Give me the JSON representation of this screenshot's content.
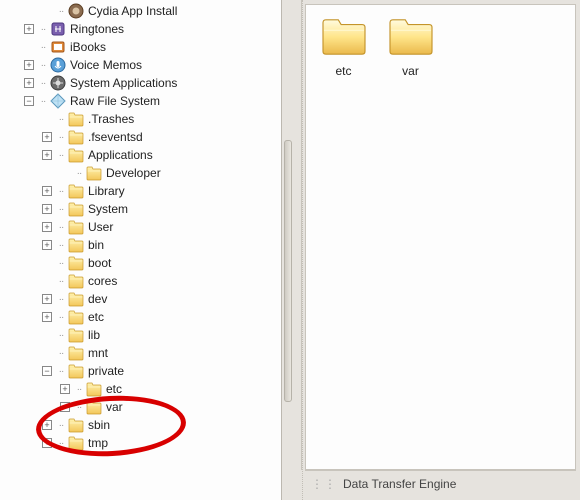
{
  "tree": {
    "top_items": [
      {
        "label": "Cydia App Install",
        "icon": "cydia",
        "depth": 2,
        "expander": "none"
      },
      {
        "label": "Ringtones",
        "icon": "ringtones",
        "depth": 1,
        "expander": "plus"
      },
      {
        "label": "iBooks",
        "icon": "ibooks",
        "depth": 1,
        "expander": "none"
      },
      {
        "label": "Voice Memos",
        "icon": "voice",
        "depth": 1,
        "expander": "plus"
      },
      {
        "label": "System Applications",
        "icon": "sysapps",
        "depth": 1,
        "expander": "plus"
      }
    ],
    "rawfs": {
      "label": "Raw File System",
      "icon": "diamond",
      "depth": 1,
      "expander": "minus",
      "children": [
        {
          "label": ".Trashes",
          "depth": 2,
          "expander": "none"
        },
        {
          "label": ".fseventsd",
          "depth": 2,
          "expander": "plus"
        },
        {
          "label": "Applications",
          "depth": 2,
          "expander": "plus"
        },
        {
          "label": "Developer",
          "depth": 3,
          "expander": "none"
        },
        {
          "label": "Library",
          "depth": 2,
          "expander": "plus"
        },
        {
          "label": "System",
          "depth": 2,
          "expander": "plus"
        },
        {
          "label": "User",
          "depth": 2,
          "expander": "plus"
        },
        {
          "label": "bin",
          "depth": 2,
          "expander": "plus"
        },
        {
          "label": "boot",
          "depth": 2,
          "expander": "none"
        },
        {
          "label": "cores",
          "depth": 2,
          "expander": "none"
        },
        {
          "label": "dev",
          "depth": 2,
          "expander": "plus"
        },
        {
          "label": "etc",
          "depth": 2,
          "expander": "plus"
        },
        {
          "label": "lib",
          "depth": 2,
          "expander": "none"
        },
        {
          "label": "mnt",
          "depth": 2,
          "expander": "none"
        },
        {
          "label": "private",
          "depth": 2,
          "expander": "minus"
        },
        {
          "label": "etc",
          "depth": 3,
          "expander": "plus"
        },
        {
          "label": "var",
          "depth": 3,
          "expander": "plus"
        },
        {
          "label": "sbin",
          "depth": 2,
          "expander": "plus"
        },
        {
          "label": "tmp",
          "depth": 2,
          "expander": "plus"
        }
      ]
    }
  },
  "content": {
    "folders": [
      {
        "name": "etc"
      },
      {
        "name": "var"
      }
    ]
  },
  "status": {
    "text": "Data Transfer Engine"
  }
}
